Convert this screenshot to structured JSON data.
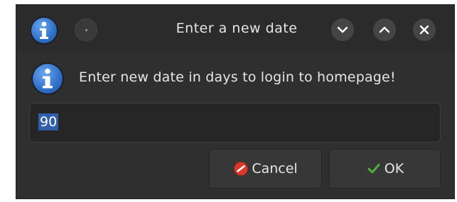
{
  "window": {
    "title": "Enter a new date"
  },
  "titlebar_icons": {
    "app_icon": "info-icon",
    "menu_icon": "menu-dot-icon",
    "minimize_icon": "chevron-down-icon",
    "maximize_icon": "chevron-up-icon",
    "close_icon": "close-icon"
  },
  "message": {
    "icon": "info-icon",
    "text": "Enter new date in days to login to homepage!"
  },
  "input": {
    "value": "90"
  },
  "buttons": {
    "cancel_label": "Cancel",
    "cancel_icon": "cancel-icon",
    "ok_label": "OK",
    "ok_icon": "check-icon"
  },
  "colors": {
    "dialog_bg": "#2f2f2f",
    "selection": "#2f5fa8",
    "cancel_icon": "#d83a2e",
    "ok_icon": "#4caf3a",
    "info_blue": "#2f6fc9"
  }
}
